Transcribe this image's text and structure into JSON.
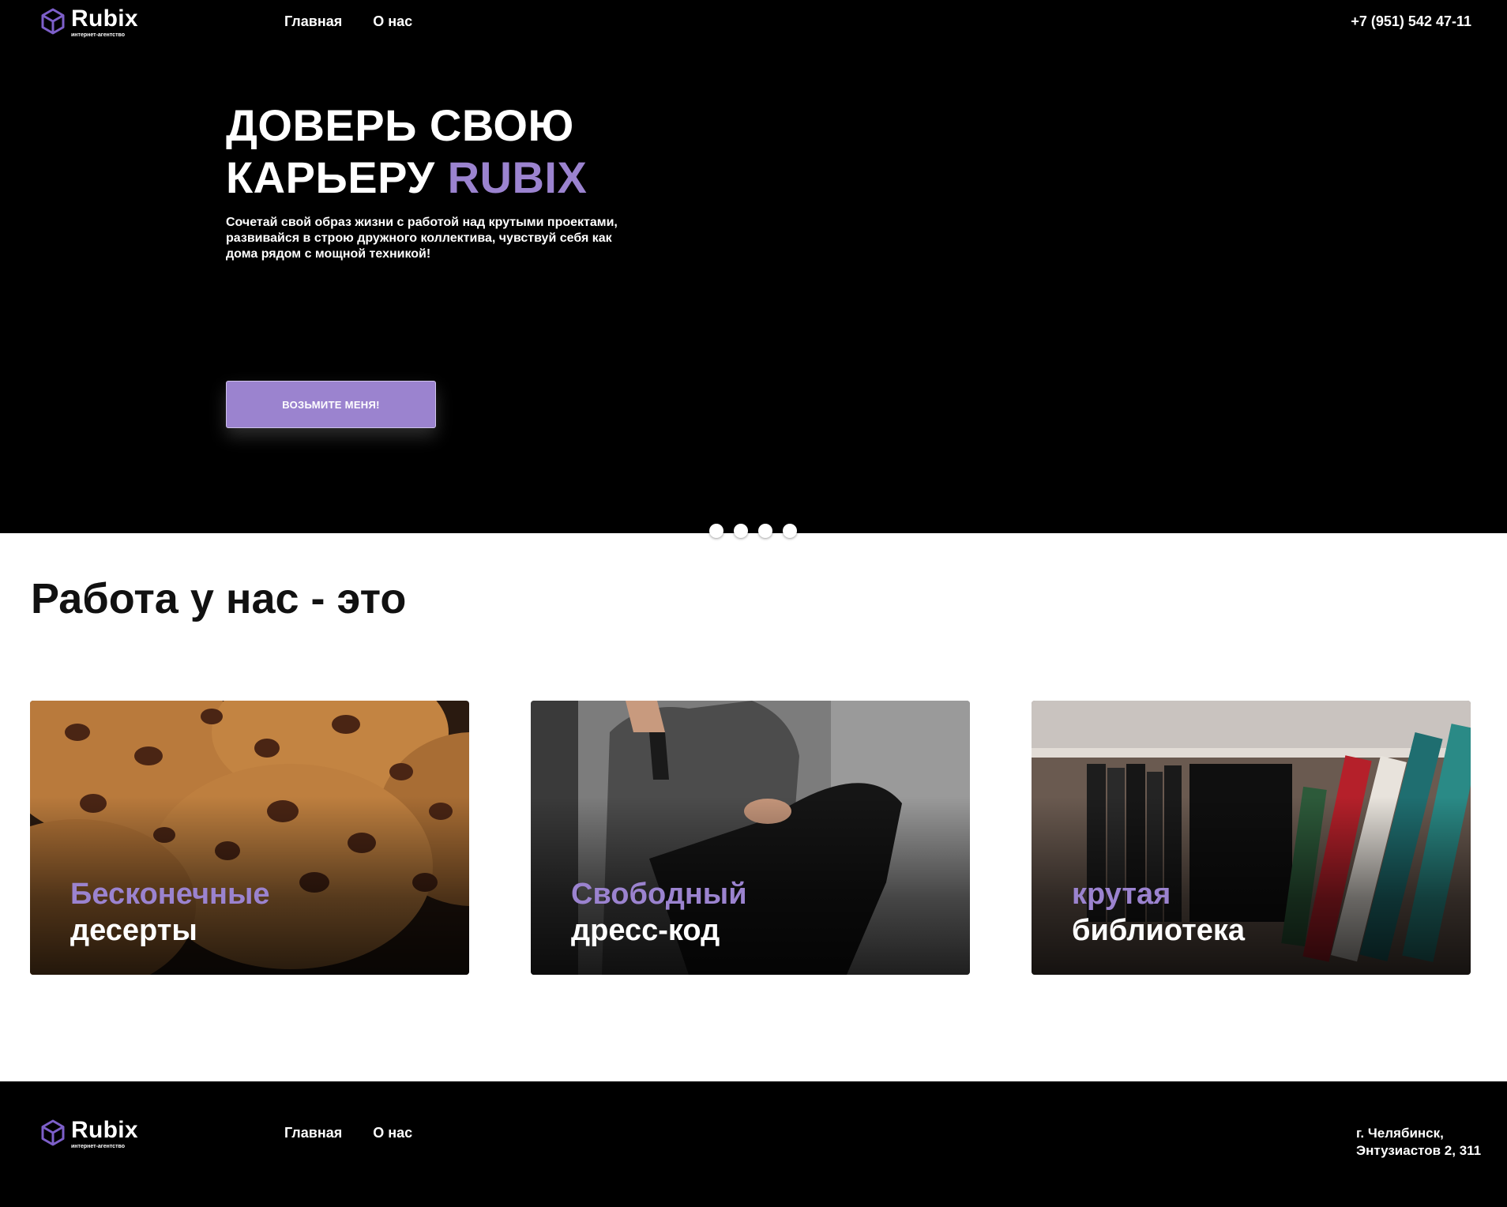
{
  "colors": {
    "accent": "#9b83cf",
    "background_dark": "#000000",
    "text_light": "#ffffff",
    "text_dark": "#111111"
  },
  "header": {
    "logo": {
      "icon": "cube-outline-icon",
      "name": "Rubix",
      "tagline": "интернет-агентство"
    },
    "nav": [
      {
        "label": "Главная"
      },
      {
        "label": "О нас"
      }
    ],
    "phone": "+7 (951) 542 47-11"
  },
  "hero": {
    "title_line1": "ДОВЕРЬ СВОЮ",
    "title_line2_start": "КАРЬЕРУ",
    "title_line2_accent": "RUBIX",
    "description": "Сочетай свой образ жизни с работой над крутыми проектами, развивайся в строю дружного коллектива, чувствуй себя как дома рядом с мощной техникой!",
    "cta_label": "ВОЗЬМИТЕ МЕНЯ!",
    "slider_dots": 4
  },
  "benefits": {
    "title": "Работа у нас - это",
    "cards": [
      {
        "accent_text": "Бесконечные",
        "text": "десерты",
        "image": "chocolate-chip-cookies"
      },
      {
        "accent_text": "Свободный",
        "text": "дресс-код",
        "image": "casual-man-sitting"
      },
      {
        "accent_text": "крутая",
        "text": "библиотека",
        "image": "bookshelf"
      }
    ]
  },
  "footer": {
    "logo": {
      "icon": "cube-outline-icon",
      "name": "Rubix",
      "tagline": "интернет-агентство"
    },
    "nav": [
      {
        "label": "Главная"
      },
      {
        "label": "О нас"
      }
    ],
    "address_line1": "г. Челябинск,",
    "address_line2": "Энтузиастов 2, 311"
  }
}
